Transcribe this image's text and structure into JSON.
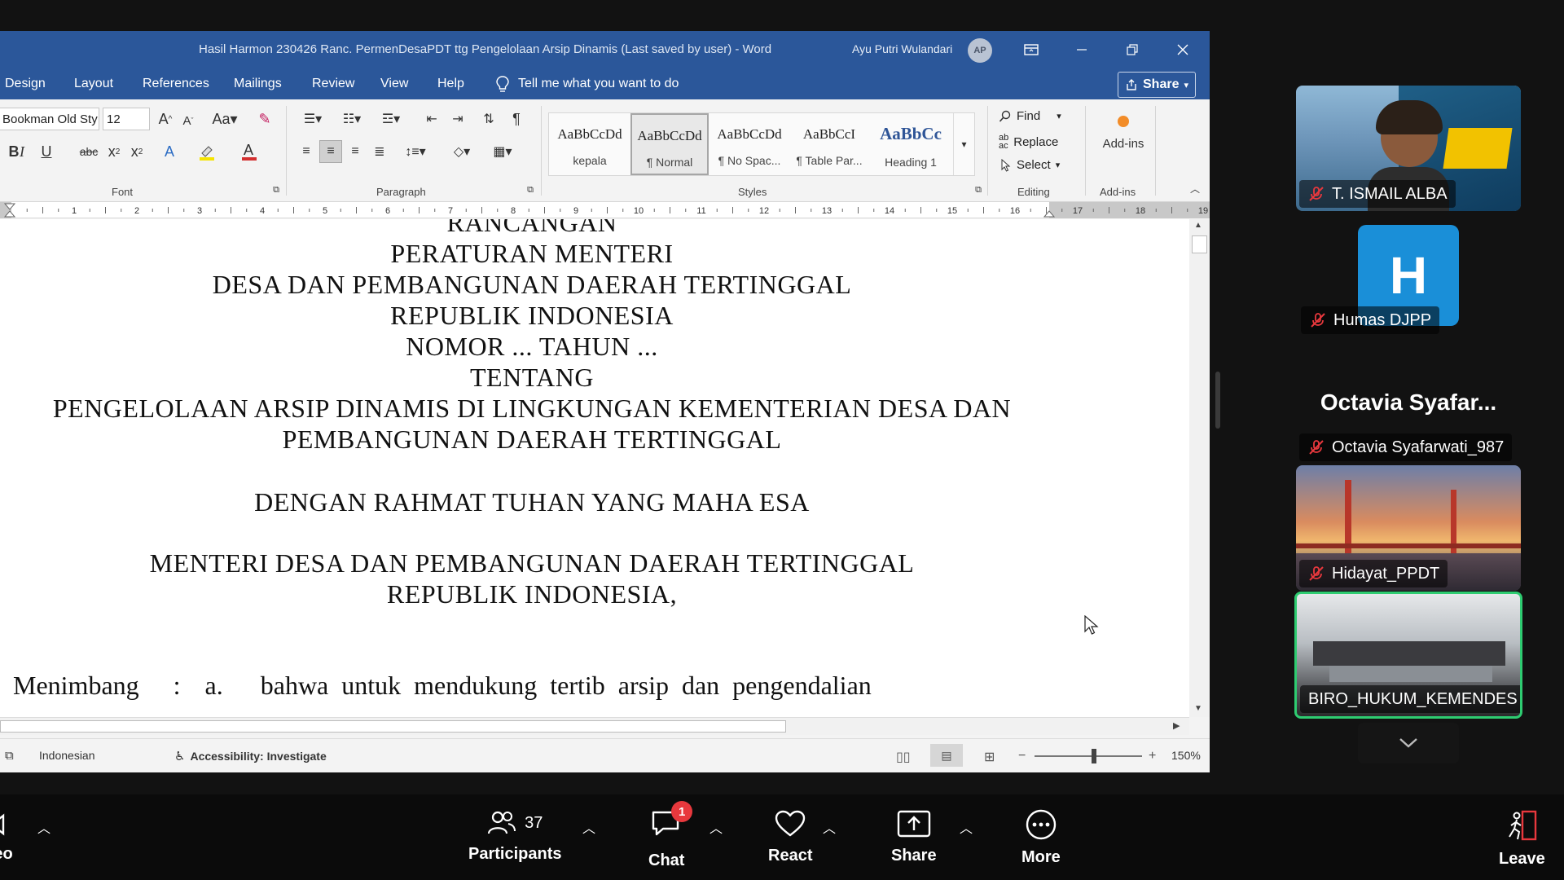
{
  "word": {
    "title": "Hasil Harmon 230426 Ranc. PermenDesaPDT ttg Pengelolaan Arsip Dinamis (Last saved by user)  -  Word",
    "user_name": "Ayu Putri Wulandari",
    "user_initials": "AP",
    "menu": [
      "Design",
      "Layout",
      "References",
      "Mailings",
      "Review",
      "View",
      "Help"
    ],
    "tell_me": "Tell me what you want to do",
    "share_label": "Share",
    "font_name": "Bookman Old Sty",
    "font_size": "12",
    "groups": {
      "font": "Font",
      "paragraph": "Paragraph",
      "styles": "Styles",
      "editing": "Editing",
      "addins": "Add-ins"
    },
    "styles": [
      {
        "sample": "AaBbCcDd",
        "name": "kepala"
      },
      {
        "sample": "AaBbCcDd",
        "name": "¶ Normal"
      },
      {
        "sample": "AaBbCcDd",
        "name": "¶ No Spac..."
      },
      {
        "sample": "AaBbCcI",
        "name": "¶ Table Par..."
      },
      {
        "sample": "AaBbCc",
        "name": "Heading 1"
      }
    ],
    "editing": {
      "find": "Find",
      "replace": "Replace",
      "select": "Select"
    },
    "addins_label": "Add-ins",
    "ruler_numbers": [
      "1",
      "2",
      "3",
      "4",
      "5",
      "6",
      "7",
      "8",
      "9",
      "10",
      "11",
      "12",
      "13",
      "14",
      "15",
      "16",
      "17",
      "18",
      "19"
    ],
    "document_lines": [
      "RANCANGAN",
      "PERATURAN MENTERI",
      "DESA DAN PEMBANGUNAN DAERAH TERTINGGAL",
      "REPUBLIK INDONESIA",
      "NOMOR ... TAHUN ...",
      "TENTANG",
      "PENGELOLAAN ARSIP DINAMIS DI LINGKUNGAN KEMENTERIAN DESA DAN",
      "PEMBANGUNAN DAERAH TERTINGGAL",
      "DENGAN RAHMAT TUHAN YANG MAHA ESA",
      "MENTERI DESA DAN PEMBANGUNAN DAERAH TERTINGGAL",
      "REPUBLIK INDONESIA,"
    ],
    "menimbang": {
      "label": "Menimbang",
      "colon": ":",
      "item": "a.",
      "text": "bahwa untuk mendukung tertib arsip dan pengendalian"
    },
    "status": {
      "language": "Indonesian",
      "accessibility": "Accessibility: Investigate",
      "zoom": "150%"
    }
  },
  "participants": {
    "tiles": [
      {
        "name": "T. ISMAIL ALBA"
      },
      {
        "name": "Humas DJPP",
        "initial": "H"
      },
      {
        "name": "Octavia Syafarwati_987",
        "heading": "Octavia  Syafar..."
      },
      {
        "name": "Hidayat_PPDT"
      },
      {
        "name": "BIRO_HUKUM_KEMENDES"
      }
    ]
  },
  "toolbar": {
    "video_label": "eo",
    "participants_label": "Participants",
    "participants_count": "37",
    "chat_label": "Chat",
    "chat_badge": "1",
    "react_label": "React",
    "share_label": "Share",
    "more_label": "More",
    "leave_label": "Leave"
  },
  "colors": {
    "word_blue": "#2b579a",
    "active_speaker": "#2ecc71",
    "badge_red": "#e8383d",
    "humas_tile": "#1a8fd8"
  }
}
